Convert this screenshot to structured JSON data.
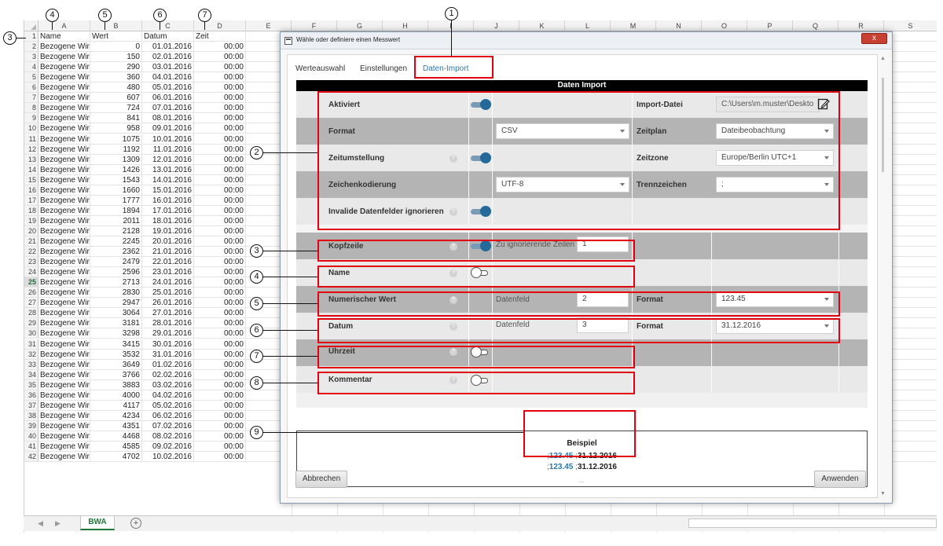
{
  "spreadsheet": {
    "columns": [
      "A",
      "B",
      "C",
      "D",
      "E",
      "F",
      "G",
      "H",
      "I",
      "J",
      "K",
      "L",
      "M",
      "N",
      "O",
      "P",
      "Q",
      "R",
      "S"
    ],
    "header_row": {
      "row_num": "1",
      "a": "Name",
      "b": "Wert",
      "c": "Datum",
      "d": "Zeit"
    },
    "rows": [
      {
        "n": "2",
        "a": "Bezogene Wir",
        "b": "0",
        "c": "01.01.2016",
        "d": "00:00"
      },
      {
        "n": "3",
        "a": "Bezogene Wir",
        "b": "150",
        "c": "02.01.2016",
        "d": "00:00"
      },
      {
        "n": "4",
        "a": "Bezogene Wir",
        "b": "290",
        "c": "03.01.2016",
        "d": "00:00"
      },
      {
        "n": "5",
        "a": "Bezogene Wir",
        "b": "360",
        "c": "04.01.2016",
        "d": "00:00"
      },
      {
        "n": "6",
        "a": "Bezogene Wir",
        "b": "480",
        "c": "05.01.2016",
        "d": "00:00"
      },
      {
        "n": "7",
        "a": "Bezogene Wir",
        "b": "607",
        "c": "06.01.2016",
        "d": "00:00"
      },
      {
        "n": "8",
        "a": "Bezogene Wir",
        "b": "724",
        "c": "07.01.2016",
        "d": "00:00"
      },
      {
        "n": "9",
        "a": "Bezogene Wir",
        "b": "841",
        "c": "08.01.2016",
        "d": "00:00"
      },
      {
        "n": "10",
        "a": "Bezogene Wir",
        "b": "958",
        "c": "09.01.2016",
        "d": "00:00"
      },
      {
        "n": "11",
        "a": "Bezogene Wir",
        "b": "1075",
        "c": "10.01.2016",
        "d": "00:00"
      },
      {
        "n": "12",
        "a": "Bezogene Wir",
        "b": "1192",
        "c": "11.01.2016",
        "d": "00:00"
      },
      {
        "n": "13",
        "a": "Bezogene Wir",
        "b": "1309",
        "c": "12.01.2016",
        "d": "00:00"
      },
      {
        "n": "14",
        "a": "Bezogene Wir",
        "b": "1426",
        "c": "13.01.2016",
        "d": "00:00"
      },
      {
        "n": "15",
        "a": "Bezogene Wir",
        "b": "1543",
        "c": "14.01.2016",
        "d": "00:00"
      },
      {
        "n": "16",
        "a": "Bezogene Wir",
        "b": "1660",
        "c": "15.01.2016",
        "d": "00:00"
      },
      {
        "n": "17",
        "a": "Bezogene Wir",
        "b": "1777",
        "c": "16.01.2016",
        "d": "00:00"
      },
      {
        "n": "18",
        "a": "Bezogene Wir",
        "b": "1894",
        "c": "17.01.2016",
        "d": "00:00"
      },
      {
        "n": "19",
        "a": "Bezogene Wir",
        "b": "2011",
        "c": "18.01.2016",
        "d": "00:00"
      },
      {
        "n": "20",
        "a": "Bezogene Wir",
        "b": "2128",
        "c": "19.01.2016",
        "d": "00:00"
      },
      {
        "n": "21",
        "a": "Bezogene Wir",
        "b": "2245",
        "c": "20.01.2016",
        "d": "00:00"
      },
      {
        "n": "22",
        "a": "Bezogene Wir",
        "b": "2362",
        "c": "21.01.2016",
        "d": "00:00"
      },
      {
        "n": "23",
        "a": "Bezogene Wir",
        "b": "2479",
        "c": "22.01.2016",
        "d": "00:00"
      },
      {
        "n": "24",
        "a": "Bezogene Wir",
        "b": "2596",
        "c": "23.01.2016",
        "d": "00:00"
      },
      {
        "n": "25",
        "a": "Bezogene Wir",
        "b": "2713",
        "c": "24.01.2016",
        "d": "00:00"
      },
      {
        "n": "26",
        "a": "Bezogene Wir",
        "b": "2830",
        "c": "25.01.2016",
        "d": "00:00"
      },
      {
        "n": "27",
        "a": "Bezogene Wir",
        "b": "2947",
        "c": "26.01.2016",
        "d": "00:00"
      },
      {
        "n": "28",
        "a": "Bezogene Wir",
        "b": "3064",
        "c": "27.01.2016",
        "d": "00:00"
      },
      {
        "n": "29",
        "a": "Bezogene Wir",
        "b": "3181",
        "c": "28.01.2016",
        "d": "00:00"
      },
      {
        "n": "30",
        "a": "Bezogene Wir",
        "b": "3298",
        "c": "29.01.2016",
        "d": "00:00"
      },
      {
        "n": "31",
        "a": "Bezogene Wir",
        "b": "3415",
        "c": "30.01.2016",
        "d": "00:00"
      },
      {
        "n": "32",
        "a": "Bezogene Wir",
        "b": "3532",
        "c": "31.01.2016",
        "d": "00:00"
      },
      {
        "n": "33",
        "a": "Bezogene Wir",
        "b": "3649",
        "c": "01.02.2016",
        "d": "00:00"
      },
      {
        "n": "34",
        "a": "Bezogene Wir",
        "b": "3766",
        "c": "02.02.2016",
        "d": "00:00"
      },
      {
        "n": "35",
        "a": "Bezogene Wir",
        "b": "3883",
        "c": "03.02.2016",
        "d": "00:00"
      },
      {
        "n": "36",
        "a": "Bezogene Wir",
        "b": "4000",
        "c": "04.02.2016",
        "d": "00:00"
      },
      {
        "n": "37",
        "a": "Bezogene Wir",
        "b": "4117",
        "c": "05.02.2016",
        "d": "00:00"
      },
      {
        "n": "38",
        "a": "Bezogene Wir",
        "b": "4234",
        "c": "06.02.2016",
        "d": "00:00"
      },
      {
        "n": "39",
        "a": "Bezogene Wir",
        "b": "4351",
        "c": "07.02.2016",
        "d": "00:00"
      },
      {
        "n": "40",
        "a": "Bezogene Wir",
        "b": "4468",
        "c": "08.02.2016",
        "d": "00:00"
      },
      {
        "n": "41",
        "a": "Bezogene Wir",
        "b": "4585",
        "c": "09.02.2016",
        "d": "00:00"
      },
      {
        "n": "42",
        "a": "Bezogene Wir",
        "b": "4702",
        "c": "10.02.2016",
        "d": "00:00"
      }
    ],
    "selected_row": "25",
    "sheet_tab": "BWA",
    "add_sheet_symbol": "+",
    "nav_prev": "◀",
    "nav_next": "▶"
  },
  "callouts": {
    "c1": "1",
    "c2": "2",
    "c3": "3",
    "c4": "4",
    "c5": "5",
    "c6": "6",
    "c7": "7",
    "c8": "8",
    "c9": "9",
    "s3": "3",
    "s4": "4",
    "s5": "5",
    "s6": "6",
    "s7": "7"
  },
  "dialog": {
    "title": "Wähle oder definiere einen Messwert",
    "close_symbol": "x",
    "tabs": [
      "Werteauswahl",
      "Einstellungen",
      "Daten-Import"
    ],
    "active_tab": "Daten-Import",
    "section_title": "Daten Import",
    "help_symbol": "?",
    "fields": {
      "aktiviert": "Aktiviert",
      "import_datei": "Import-Datei",
      "import_datei_value": "C:\\Users\\m.muster\\Deskto",
      "format": "Format",
      "format_value": "CSV",
      "zeitplan": "Zeitplan",
      "zeitplan_value": "Dateibeobachtung",
      "zeitumstellung": "Zeitumstellung",
      "zeitzone": "Zeitzone",
      "zeitzone_value": "Europe/Berlin UTC+1",
      "zeichenkodierung": "Zeichenkodierung",
      "zeichenkodierung_value": "UTF-8",
      "trennzeichen": "Trennzeichen",
      "trennzeichen_value": ";",
      "invalide": "Invalide Datenfelder ignorieren",
      "kopfzeile": "Kopfzeile",
      "zu_ignorierende": "Zu ignorierende Zeilen",
      "zu_ignorierende_value": "1",
      "name": "Name",
      "numerischer_wert": "Numerischer Wert",
      "datenfeld": "Datenfeld",
      "num_datenfeld_value": "2",
      "num_format_label": "Format",
      "num_format_value": "123.45",
      "datum": "Datum",
      "datum_datenfeld_value": "3",
      "datum_format_label": "Format",
      "datum_format_value": "31.12.2016",
      "uhrzeit": "Uhrzeit",
      "kommentar": "Kommentar"
    },
    "example": {
      "title": "Beispiel",
      "sep": ";",
      "line1_num": "123.45",
      "line1_date": "31.12.2016",
      "line2_num": "123.45",
      "line2_date": "31.12.2016",
      "dots": "..."
    },
    "buttons": {
      "cancel": "Abbrechen",
      "apply": "Anwenden"
    },
    "scroll_up": "▲",
    "scroll_down": "▼"
  }
}
